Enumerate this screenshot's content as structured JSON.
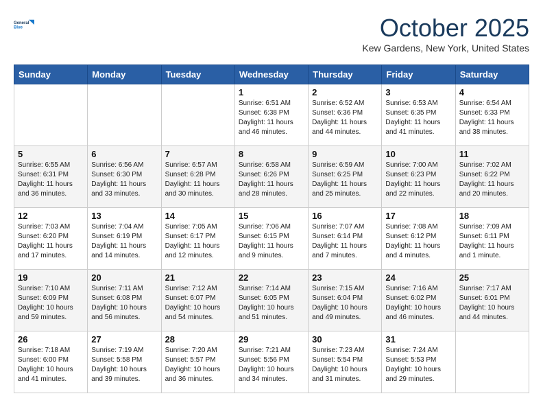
{
  "header": {
    "logo_line1": "General",
    "logo_line2": "Blue",
    "month_title": "October 2025",
    "location": "Kew Gardens, New York, United States"
  },
  "days_of_week": [
    "Sunday",
    "Monday",
    "Tuesday",
    "Wednesday",
    "Thursday",
    "Friday",
    "Saturday"
  ],
  "weeks": [
    [
      {
        "day": "",
        "info": ""
      },
      {
        "day": "",
        "info": ""
      },
      {
        "day": "",
        "info": ""
      },
      {
        "day": "1",
        "info": "Sunrise: 6:51 AM\nSunset: 6:38 PM\nDaylight: 11 hours\nand 46 minutes."
      },
      {
        "day": "2",
        "info": "Sunrise: 6:52 AM\nSunset: 6:36 PM\nDaylight: 11 hours\nand 44 minutes."
      },
      {
        "day": "3",
        "info": "Sunrise: 6:53 AM\nSunset: 6:35 PM\nDaylight: 11 hours\nand 41 minutes."
      },
      {
        "day": "4",
        "info": "Sunrise: 6:54 AM\nSunset: 6:33 PM\nDaylight: 11 hours\nand 38 minutes."
      }
    ],
    [
      {
        "day": "5",
        "info": "Sunrise: 6:55 AM\nSunset: 6:31 PM\nDaylight: 11 hours\nand 36 minutes."
      },
      {
        "day": "6",
        "info": "Sunrise: 6:56 AM\nSunset: 6:30 PM\nDaylight: 11 hours\nand 33 minutes."
      },
      {
        "day": "7",
        "info": "Sunrise: 6:57 AM\nSunset: 6:28 PM\nDaylight: 11 hours\nand 30 minutes."
      },
      {
        "day": "8",
        "info": "Sunrise: 6:58 AM\nSunset: 6:26 PM\nDaylight: 11 hours\nand 28 minutes."
      },
      {
        "day": "9",
        "info": "Sunrise: 6:59 AM\nSunset: 6:25 PM\nDaylight: 11 hours\nand 25 minutes."
      },
      {
        "day": "10",
        "info": "Sunrise: 7:00 AM\nSunset: 6:23 PM\nDaylight: 11 hours\nand 22 minutes."
      },
      {
        "day": "11",
        "info": "Sunrise: 7:02 AM\nSunset: 6:22 PM\nDaylight: 11 hours\nand 20 minutes."
      }
    ],
    [
      {
        "day": "12",
        "info": "Sunrise: 7:03 AM\nSunset: 6:20 PM\nDaylight: 11 hours\nand 17 minutes."
      },
      {
        "day": "13",
        "info": "Sunrise: 7:04 AM\nSunset: 6:19 PM\nDaylight: 11 hours\nand 14 minutes."
      },
      {
        "day": "14",
        "info": "Sunrise: 7:05 AM\nSunset: 6:17 PM\nDaylight: 11 hours\nand 12 minutes."
      },
      {
        "day": "15",
        "info": "Sunrise: 7:06 AM\nSunset: 6:15 PM\nDaylight: 11 hours\nand 9 minutes."
      },
      {
        "day": "16",
        "info": "Sunrise: 7:07 AM\nSunset: 6:14 PM\nDaylight: 11 hours\nand 7 minutes."
      },
      {
        "day": "17",
        "info": "Sunrise: 7:08 AM\nSunset: 6:12 PM\nDaylight: 11 hours\nand 4 minutes."
      },
      {
        "day": "18",
        "info": "Sunrise: 7:09 AM\nSunset: 6:11 PM\nDaylight: 11 hours\nand 1 minute."
      }
    ],
    [
      {
        "day": "19",
        "info": "Sunrise: 7:10 AM\nSunset: 6:09 PM\nDaylight: 10 hours\nand 59 minutes."
      },
      {
        "day": "20",
        "info": "Sunrise: 7:11 AM\nSunset: 6:08 PM\nDaylight: 10 hours\nand 56 minutes."
      },
      {
        "day": "21",
        "info": "Sunrise: 7:12 AM\nSunset: 6:07 PM\nDaylight: 10 hours\nand 54 minutes."
      },
      {
        "day": "22",
        "info": "Sunrise: 7:14 AM\nSunset: 6:05 PM\nDaylight: 10 hours\nand 51 minutes."
      },
      {
        "day": "23",
        "info": "Sunrise: 7:15 AM\nSunset: 6:04 PM\nDaylight: 10 hours\nand 49 minutes."
      },
      {
        "day": "24",
        "info": "Sunrise: 7:16 AM\nSunset: 6:02 PM\nDaylight: 10 hours\nand 46 minutes."
      },
      {
        "day": "25",
        "info": "Sunrise: 7:17 AM\nSunset: 6:01 PM\nDaylight: 10 hours\nand 44 minutes."
      }
    ],
    [
      {
        "day": "26",
        "info": "Sunrise: 7:18 AM\nSunset: 6:00 PM\nDaylight: 10 hours\nand 41 minutes."
      },
      {
        "day": "27",
        "info": "Sunrise: 7:19 AM\nSunset: 5:58 PM\nDaylight: 10 hours\nand 39 minutes."
      },
      {
        "day": "28",
        "info": "Sunrise: 7:20 AM\nSunset: 5:57 PM\nDaylight: 10 hours\nand 36 minutes."
      },
      {
        "day": "29",
        "info": "Sunrise: 7:21 AM\nSunset: 5:56 PM\nDaylight: 10 hours\nand 34 minutes."
      },
      {
        "day": "30",
        "info": "Sunrise: 7:23 AM\nSunset: 5:54 PM\nDaylight: 10 hours\nand 31 minutes."
      },
      {
        "day": "31",
        "info": "Sunrise: 7:24 AM\nSunset: 5:53 PM\nDaylight: 10 hours\nand 29 minutes."
      },
      {
        "day": "",
        "info": ""
      }
    ]
  ]
}
